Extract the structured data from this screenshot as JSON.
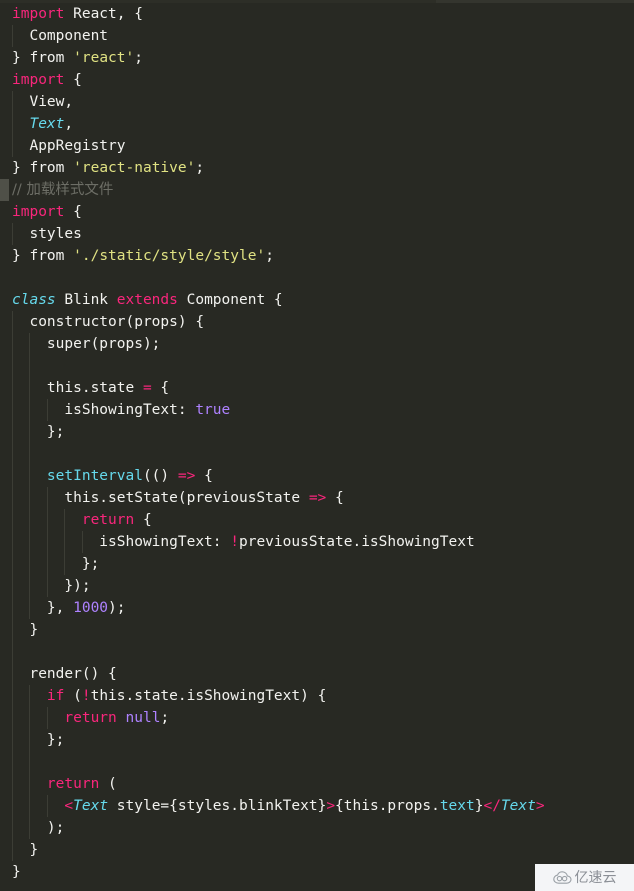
{
  "editor": {
    "theme_name": "monokai-dark",
    "background_color": "#282923",
    "default_text_color": "#f2f2ef",
    "language": "javascript-jsx",
    "indent_guide_color": "#3c3d35",
    "line_marker_color": "#4f5048",
    "colors": {
      "keyword": "#f9267c",
      "string": "#e0e283",
      "class_type": "#66d9ec",
      "function": "#66d9ec",
      "number_constant": "#ae82ff",
      "comment": "#6d6e66",
      "operator": "#f9267c",
      "plain": "#f2f2ef"
    },
    "lines": [
      {
        "n": 1,
        "indent": 0,
        "guides": [],
        "marker": false,
        "tokens": [
          {
            "t": "import",
            "c": "kw"
          },
          {
            "t": " React, {",
            "c": "pln"
          }
        ]
      },
      {
        "n": 2,
        "indent": 0,
        "guides": [
          1
        ],
        "marker": false,
        "tokens": [
          {
            "t": "  Component",
            "c": "pln"
          }
        ]
      },
      {
        "n": 3,
        "indent": 0,
        "guides": [],
        "marker": false,
        "tokens": [
          {
            "t": "} ",
            "c": "pln"
          },
          {
            "t": "from",
            "c": "pln"
          },
          {
            "t": " ",
            "c": "pln"
          },
          {
            "t": "'react'",
            "c": "str"
          },
          {
            "t": ";",
            "c": "pln"
          }
        ]
      },
      {
        "n": 4,
        "indent": 0,
        "guides": [],
        "marker": false,
        "tokens": [
          {
            "t": "import",
            "c": "kw"
          },
          {
            "t": " {",
            "c": "pln"
          }
        ]
      },
      {
        "n": 5,
        "indent": 0,
        "guides": [
          1
        ],
        "marker": false,
        "tokens": [
          {
            "t": "  View,",
            "c": "pln"
          }
        ]
      },
      {
        "n": 6,
        "indent": 0,
        "guides": [
          1
        ],
        "marker": false,
        "tokens": [
          {
            "t": "  ",
            "c": "pln"
          },
          {
            "t": "Text",
            "c": "cls"
          },
          {
            "t": ",",
            "c": "pln"
          }
        ]
      },
      {
        "n": 7,
        "indent": 0,
        "guides": [
          1
        ],
        "marker": false,
        "tokens": [
          {
            "t": "  AppRegistry",
            "c": "pln"
          }
        ]
      },
      {
        "n": 8,
        "indent": 0,
        "guides": [],
        "marker": false,
        "tokens": [
          {
            "t": "} ",
            "c": "pln"
          },
          {
            "t": "from",
            "c": "pln"
          },
          {
            "t": " ",
            "c": "pln"
          },
          {
            "t": "'react-native'",
            "c": "str"
          },
          {
            "t": ";",
            "c": "pln"
          }
        ]
      },
      {
        "n": 9,
        "indent": 0,
        "guides": [],
        "marker": true,
        "tokens": [
          {
            "t": "// 加载样式文件",
            "c": "com"
          }
        ]
      },
      {
        "n": 10,
        "indent": 0,
        "guides": [],
        "marker": false,
        "tokens": [
          {
            "t": "import",
            "c": "kw"
          },
          {
            "t": " {",
            "c": "pln"
          }
        ]
      },
      {
        "n": 11,
        "indent": 0,
        "guides": [
          1
        ],
        "marker": false,
        "tokens": [
          {
            "t": "  styles",
            "c": "pln"
          }
        ]
      },
      {
        "n": 12,
        "indent": 0,
        "guides": [],
        "marker": false,
        "tokens": [
          {
            "t": "} ",
            "c": "pln"
          },
          {
            "t": "from",
            "c": "pln"
          },
          {
            "t": " ",
            "c": "pln"
          },
          {
            "t": "'./static/style/style'",
            "c": "str"
          },
          {
            "t": ";",
            "c": "pln"
          }
        ]
      },
      {
        "n": 13,
        "indent": 0,
        "guides": [],
        "marker": false,
        "tokens": []
      },
      {
        "n": 14,
        "indent": 0,
        "guides": [],
        "marker": false,
        "tokens": [
          {
            "t": "class",
            "c": "cls"
          },
          {
            "t": " Blink ",
            "c": "pln"
          },
          {
            "t": "extends",
            "c": "kw"
          },
          {
            "t": " Component {",
            "c": "pln"
          }
        ]
      },
      {
        "n": 15,
        "indent": 1,
        "guides": [
          1
        ],
        "marker": false,
        "tokens": [
          {
            "t": "  constructor(props) {",
            "c": "pln"
          }
        ]
      },
      {
        "n": 16,
        "indent": 2,
        "guides": [
          1,
          2
        ],
        "marker": false,
        "tokens": [
          {
            "t": "    super(props);",
            "c": "pln"
          }
        ]
      },
      {
        "n": 17,
        "indent": 0,
        "guides": [
          1,
          2
        ],
        "marker": false,
        "tokens": []
      },
      {
        "n": 18,
        "indent": 2,
        "guides": [
          1,
          2
        ],
        "marker": false,
        "tokens": [
          {
            "t": "    this.state ",
            "c": "pln"
          },
          {
            "t": "=",
            "c": "op"
          },
          {
            "t": " {",
            "c": "pln"
          }
        ]
      },
      {
        "n": 19,
        "indent": 3,
        "guides": [
          1,
          2,
          3
        ],
        "marker": false,
        "tokens": [
          {
            "t": "      isShowingText: ",
            "c": "pln"
          },
          {
            "t": "true",
            "c": "num"
          }
        ]
      },
      {
        "n": 20,
        "indent": 2,
        "guides": [
          1,
          2
        ],
        "marker": false,
        "tokens": [
          {
            "t": "    };",
            "c": "pln"
          }
        ]
      },
      {
        "n": 21,
        "indent": 0,
        "guides": [
          1,
          2
        ],
        "marker": false,
        "tokens": []
      },
      {
        "n": 22,
        "indent": 2,
        "guides": [
          1,
          2
        ],
        "marker": false,
        "tokens": [
          {
            "t": "    ",
            "c": "pln"
          },
          {
            "t": "setInterval",
            "c": "fn"
          },
          {
            "t": "(() ",
            "c": "pln"
          },
          {
            "t": "=>",
            "c": "op"
          },
          {
            "t": " {",
            "c": "pln"
          }
        ]
      },
      {
        "n": 23,
        "indent": 3,
        "guides": [
          1,
          2,
          3
        ],
        "marker": false,
        "tokens": [
          {
            "t": "      this.setState(previousState ",
            "c": "pln"
          },
          {
            "t": "=>",
            "c": "op"
          },
          {
            "t": " {",
            "c": "pln"
          }
        ]
      },
      {
        "n": 24,
        "indent": 4,
        "guides": [
          1,
          2,
          3,
          4
        ],
        "marker": false,
        "tokens": [
          {
            "t": "        ",
            "c": "pln"
          },
          {
            "t": "return",
            "c": "kw"
          },
          {
            "t": " {",
            "c": "pln"
          }
        ]
      },
      {
        "n": 25,
        "indent": 5,
        "guides": [
          1,
          2,
          3,
          4,
          5
        ],
        "marker": false,
        "tokens": [
          {
            "t": "          isShowingText: ",
            "c": "pln"
          },
          {
            "t": "!",
            "c": "op"
          },
          {
            "t": "previousState.isShowingText",
            "c": "pln"
          }
        ]
      },
      {
        "n": 26,
        "indent": 4,
        "guides": [
          1,
          2,
          3,
          4
        ],
        "marker": false,
        "tokens": [
          {
            "t": "        };",
            "c": "pln"
          }
        ]
      },
      {
        "n": 27,
        "indent": 3,
        "guides": [
          1,
          2,
          3
        ],
        "marker": false,
        "tokens": [
          {
            "t": "      });",
            "c": "pln"
          }
        ]
      },
      {
        "n": 28,
        "indent": 2,
        "guides": [
          1,
          2
        ],
        "marker": false,
        "tokens": [
          {
            "t": "    }, ",
            "c": "pln"
          },
          {
            "t": "1000",
            "c": "num"
          },
          {
            "t": ");",
            "c": "pln"
          }
        ]
      },
      {
        "n": 29,
        "indent": 1,
        "guides": [
          1
        ],
        "marker": false,
        "tokens": [
          {
            "t": "  }",
            "c": "pln"
          }
        ]
      },
      {
        "n": 30,
        "indent": 0,
        "guides": [
          1
        ],
        "marker": false,
        "tokens": []
      },
      {
        "n": 31,
        "indent": 1,
        "guides": [
          1
        ],
        "marker": false,
        "tokens": [
          {
            "t": "  render() {",
            "c": "pln"
          }
        ]
      },
      {
        "n": 32,
        "indent": 2,
        "guides": [
          1,
          2
        ],
        "marker": false,
        "tokens": [
          {
            "t": "    ",
            "c": "pln"
          },
          {
            "t": "if",
            "c": "kw"
          },
          {
            "t": " (",
            "c": "pln"
          },
          {
            "t": "!",
            "c": "op"
          },
          {
            "t": "this.state.isShowingText) {",
            "c": "pln"
          }
        ]
      },
      {
        "n": 33,
        "indent": 3,
        "guides": [
          1,
          2,
          3
        ],
        "marker": false,
        "tokens": [
          {
            "t": "      ",
            "c": "pln"
          },
          {
            "t": "return",
            "c": "kw"
          },
          {
            "t": " ",
            "c": "pln"
          },
          {
            "t": "null",
            "c": "num"
          },
          {
            "t": ";",
            "c": "pln"
          }
        ]
      },
      {
        "n": 34,
        "indent": 2,
        "guides": [
          1,
          2
        ],
        "marker": false,
        "tokens": [
          {
            "t": "    };",
            "c": "pln"
          }
        ]
      },
      {
        "n": 35,
        "indent": 0,
        "guides": [
          1,
          2
        ],
        "marker": false,
        "tokens": []
      },
      {
        "n": 36,
        "indent": 2,
        "guides": [
          1,
          2
        ],
        "marker": false,
        "tokens": [
          {
            "t": "    ",
            "c": "pln"
          },
          {
            "t": "return",
            "c": "kw"
          },
          {
            "t": " (",
            "c": "pln"
          }
        ]
      },
      {
        "n": 37,
        "indent": 3,
        "guides": [
          1,
          2,
          3
        ],
        "marker": false,
        "tokens": [
          {
            "t": "      ",
            "c": "pln"
          },
          {
            "t": "<",
            "c": "op"
          },
          {
            "t": "Text",
            "c": "cls"
          },
          {
            "t": " style=",
            "c": "pln"
          },
          {
            "t": "{",
            "c": "pln"
          },
          {
            "t": "styles.blinkText",
            "c": "pln"
          },
          {
            "t": "}",
            "c": "pln"
          },
          {
            "t": ">",
            "c": "op"
          },
          {
            "t": "{this.props.",
            "c": "pln"
          },
          {
            "t": "text",
            "c": "fn"
          },
          {
            "t": "}",
            "c": "pln"
          },
          {
            "t": "</",
            "c": "op"
          },
          {
            "t": "Text",
            "c": "cls"
          },
          {
            "t": ">",
            "c": "op"
          }
        ]
      },
      {
        "n": 38,
        "indent": 2,
        "guides": [
          1,
          2
        ],
        "marker": false,
        "tokens": [
          {
            "t": "    );",
            "c": "pln"
          }
        ]
      },
      {
        "n": 39,
        "indent": 1,
        "guides": [
          1
        ],
        "marker": false,
        "tokens": [
          {
            "t": "  }",
            "c": "pln"
          }
        ]
      },
      {
        "n": 40,
        "indent": 0,
        "guides": [],
        "marker": false,
        "tokens": [
          {
            "t": "}",
            "c": "pln"
          }
        ]
      }
    ]
  },
  "watermark": {
    "text": "亿速云",
    "icon": "cloud-icon",
    "background_color": "#f4f5f7",
    "text_color": "#8b8f96"
  }
}
